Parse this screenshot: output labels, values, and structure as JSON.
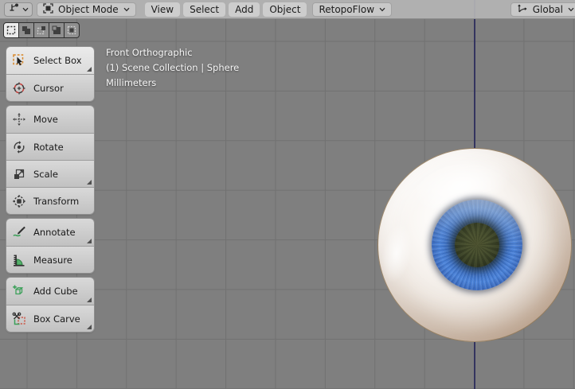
{
  "header": {
    "editor_selector": {
      "icon": "editor-type-3d-viewport-icon"
    },
    "mode_dropdown": {
      "label": "Object Mode",
      "icon": "object-mode-icon"
    },
    "menus": [
      {
        "label": "View"
      },
      {
        "label": "Select"
      },
      {
        "label": "Add"
      },
      {
        "label": "Object"
      }
    ],
    "retopoflow_dropdown": {
      "label": "RetopoFlow"
    },
    "orientation_dropdown": {
      "label": "Global",
      "icon": "global-orientation-icon"
    }
  },
  "select_modes": [
    {
      "name": "new",
      "active": true
    },
    {
      "name": "extend",
      "active": false
    },
    {
      "name": "subtract",
      "active": false
    },
    {
      "name": "invert",
      "active": false
    },
    {
      "name": "intersect",
      "active": false
    }
  ],
  "viewport": {
    "overlay": {
      "line1": "Front Orthographic",
      "line2": "(1) Scene Collection | Sphere",
      "line3": "Millimeters"
    },
    "object": "eyeball-sphere",
    "colors": {
      "background": "#7f7f7f",
      "grid_line": "#717171",
      "axis_line": "#34345f",
      "iris_blue": "#4c84da",
      "pupil_olive": "#3c4128",
      "sclera": "#f0eae4"
    }
  },
  "toolbar": {
    "items": [
      {
        "label": "Select Box",
        "icon": "select-box-icon",
        "active": true,
        "has_subtools": true
      },
      {
        "label": "Cursor",
        "icon": "cursor-icon",
        "active": false,
        "has_subtools": false
      },
      {
        "label": "Move",
        "icon": "move-icon",
        "active": false,
        "has_subtools": false
      },
      {
        "label": "Rotate",
        "icon": "rotate-icon",
        "active": false,
        "has_subtools": false
      },
      {
        "label": "Scale",
        "icon": "scale-icon",
        "active": false,
        "has_subtools": true
      },
      {
        "label": "Transform",
        "icon": "transform-icon",
        "active": false,
        "has_subtools": false
      },
      {
        "label": "Annotate",
        "icon": "annotate-icon",
        "active": false,
        "has_subtools": true
      },
      {
        "label": "Measure",
        "icon": "measure-icon",
        "active": false,
        "has_subtools": false
      },
      {
        "label": "Add Cube",
        "icon": "add-cube-icon",
        "active": false,
        "has_subtools": true
      },
      {
        "label": "Box Carve",
        "icon": "box-carve-icon",
        "active": false,
        "has_subtools": true
      }
    ]
  }
}
